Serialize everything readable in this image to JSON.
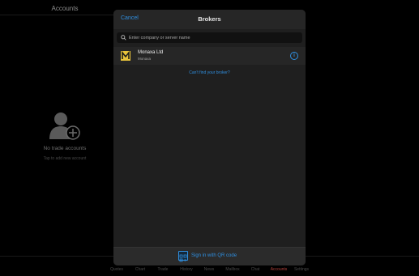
{
  "background": {
    "title": "Accounts",
    "empty_title": "No trade accounts",
    "empty_hint": "Tap to add new account"
  },
  "tabbar": {
    "items": [
      {
        "label": "Quotes",
        "active": false
      },
      {
        "label": "Chart",
        "active": false
      },
      {
        "label": "Trade",
        "active": false
      },
      {
        "label": "History",
        "active": false
      },
      {
        "label": "News",
        "active": false
      },
      {
        "label": "Mailbox",
        "active": false
      },
      {
        "label": "Chat",
        "active": false
      },
      {
        "label": "Accounts",
        "active": true
      },
      {
        "label": "Settings",
        "active": false
      }
    ]
  },
  "modal": {
    "title": "Brokers",
    "cancel_label": "Cancel",
    "search_placeholder": "Enter company or server name",
    "brokers": [
      {
        "name": "Monaxa Ltd",
        "subtitle": "Monaxa",
        "logo_icon": "monaxa-logo"
      }
    ],
    "cant_find_label": "Can't find your broker?",
    "qr_label": "Sign in with QR code"
  },
  "colors": {
    "accent": "#2f8fe0",
    "active_tab": "#b0403a",
    "logo": "#e8c33a"
  }
}
